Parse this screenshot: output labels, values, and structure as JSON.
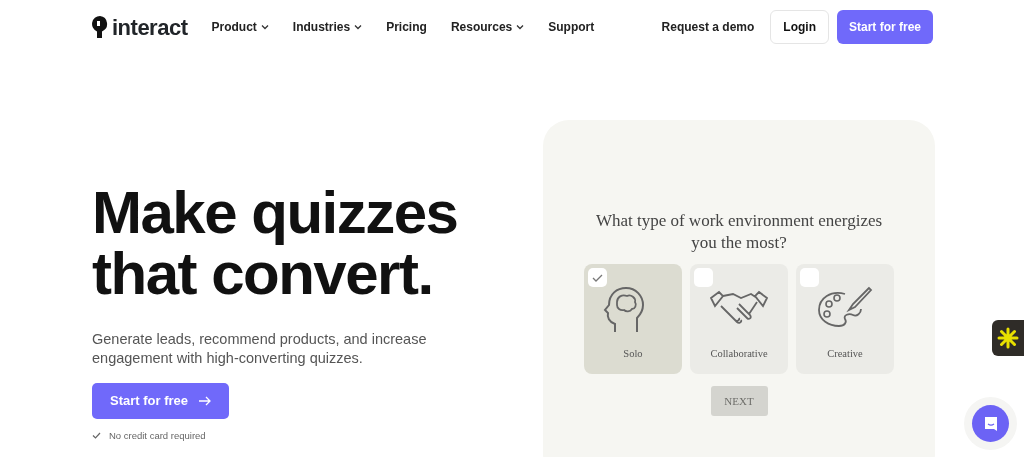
{
  "brand": "interact",
  "nav": [
    {
      "label": "Product",
      "dropdown": true
    },
    {
      "label": "Industries",
      "dropdown": true
    },
    {
      "label": "Pricing",
      "dropdown": false
    },
    {
      "label": "Resources",
      "dropdown": true
    },
    {
      "label": "Support",
      "dropdown": false
    }
  ],
  "nav_actions": {
    "demo": "Request a demo",
    "login": "Login",
    "start": "Start for free"
  },
  "hero": {
    "title_lines": [
      "Make quizzes",
      "that convert."
    ],
    "subtitle": "Generate leads, recommend products, and increase engagement with high-converting quizzes.",
    "cta": "Start for free",
    "note": "No credit card required"
  },
  "quiz": {
    "question": "What type of work environment energizes you the most?",
    "options": [
      {
        "label": "Solo",
        "kind": "brain",
        "selected": true
      },
      {
        "label": "Collaborative",
        "kind": "handshake",
        "selected": false
      },
      {
        "label": "Creative",
        "kind": "palette",
        "selected": false
      }
    ],
    "next": {
      "label": "NEXT",
      "disabled": true
    }
  }
}
